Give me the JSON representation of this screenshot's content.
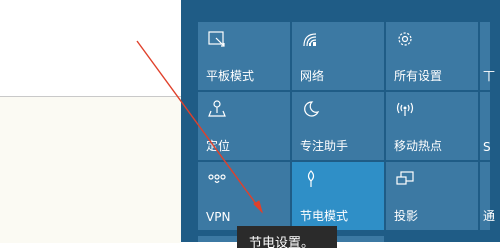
{
  "quick_actions": {
    "tiles": [
      {
        "label": "平板模式",
        "icon": "tablet-mode-icon"
      },
      {
        "label": "网络",
        "icon": "network-icon"
      },
      {
        "label": "所有设置",
        "icon": "settings-gear-icon"
      },
      {
        "label": "定位",
        "icon": "location-icon"
      },
      {
        "label": "专注助手",
        "icon": "focus-assist-moon-icon"
      },
      {
        "label": "移动热点",
        "icon": "mobile-hotspot-icon"
      },
      {
        "label": "VPN",
        "icon": "vpn-icon"
      },
      {
        "label": "节电模式",
        "icon": "battery-saver-icon"
      },
      {
        "label": "投影",
        "icon": "project-icon"
      }
    ],
    "edge_labels": [
      "丅",
      "S",
      "通"
    ],
    "active_tile": "节电模式"
  },
  "tooltip": {
    "text": "节电设置。"
  },
  "colors": {
    "panel_bg": "#1f5c86",
    "tile_bg": "#3c79a3",
    "tile_active": "#2f8fc7",
    "arrow": "#e0412b"
  }
}
